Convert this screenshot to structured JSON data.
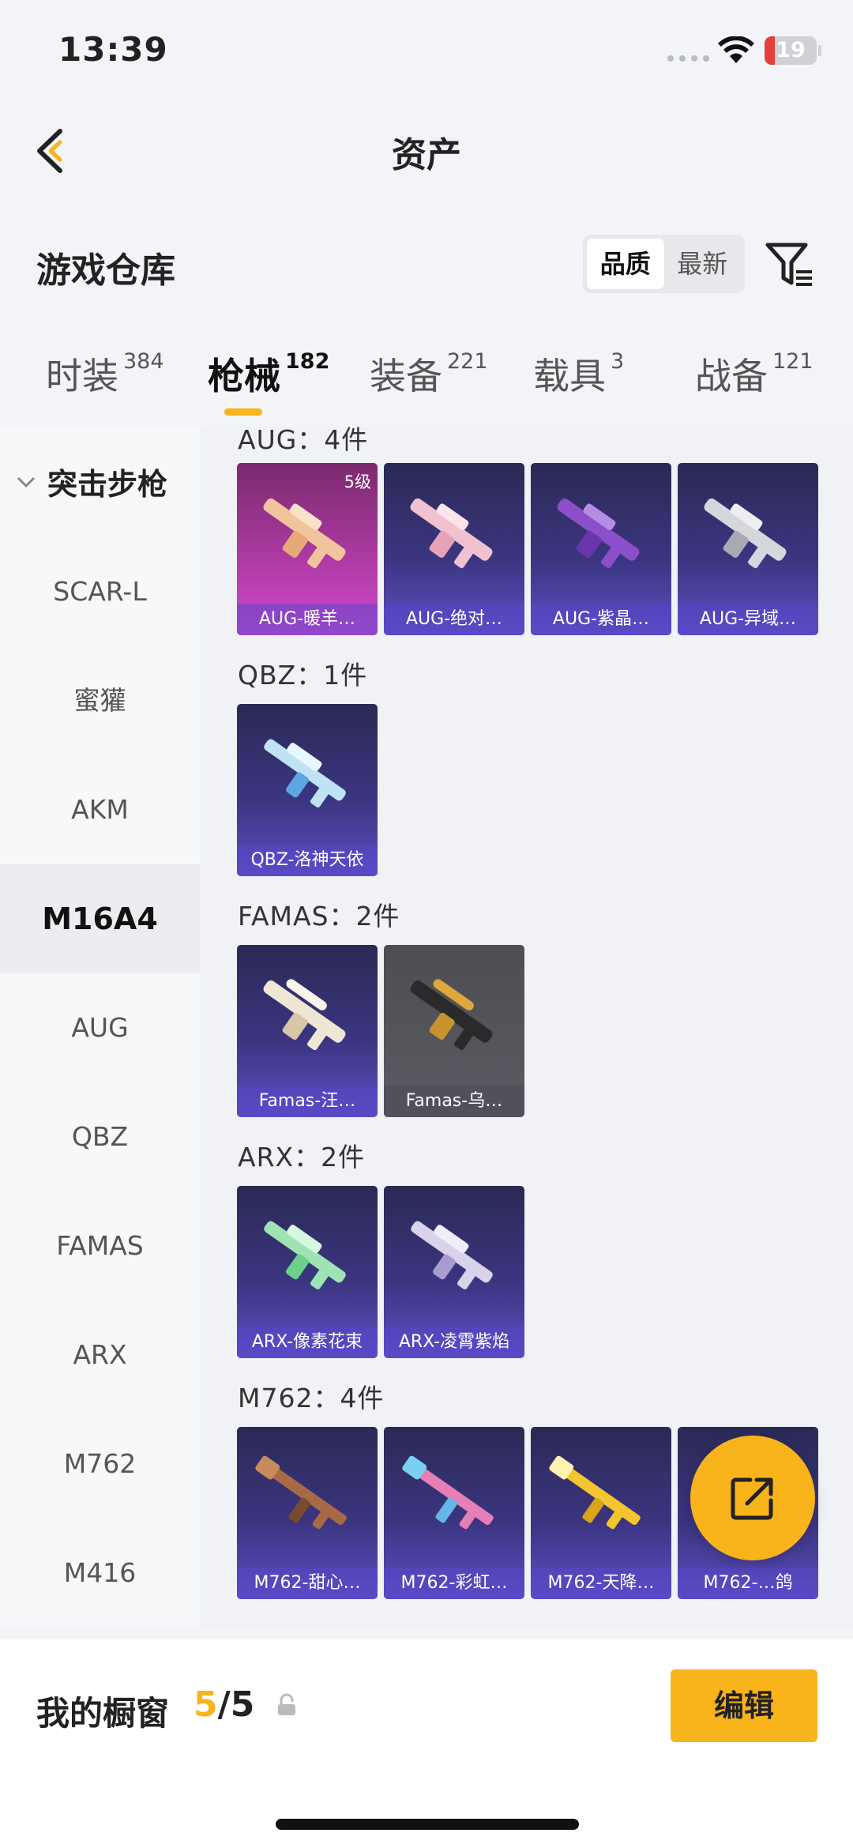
{
  "status": {
    "time": "13:39",
    "battery": "19",
    "battery_level": 0.19
  },
  "nav": {
    "title": "资产"
  },
  "header": {
    "title": "游戏仓库",
    "sort_options": [
      "品质",
      "最新"
    ],
    "sort_active": "品质"
  },
  "tabs": [
    {
      "label": "时装",
      "count": "384"
    },
    {
      "label": "枪械",
      "count": "182"
    },
    {
      "label": "装备",
      "count": "221"
    },
    {
      "label": "载具",
      "count": "3"
    },
    {
      "label": "战备",
      "count": "121"
    }
  ],
  "active_tab": "枪械",
  "sidebar": {
    "category": "突击步枪",
    "items": [
      "SCAR-L",
      "蜜獾",
      "AKM",
      "M16A4",
      "AUG",
      "QBZ",
      "FAMAS",
      "ARX",
      "M762",
      "M416"
    ],
    "active": "M16A4"
  },
  "groups": [
    {
      "title": "AUG：4件",
      "items": [
        {
          "name": "AUG-暖羊…",
          "level": "5级",
          "style": "pink"
        },
        {
          "name": "AUG-绝对…",
          "style": "purple"
        },
        {
          "name": "AUG-紫晶…",
          "style": "purple"
        },
        {
          "name": "AUG-异域…",
          "style": "purple"
        }
      ]
    },
    {
      "title": "QBZ：1件",
      "items": [
        {
          "name": "QBZ-洛神天依",
          "style": "purple"
        }
      ]
    },
    {
      "title": "FAMAS：2件",
      "items": [
        {
          "name": "Famas-汪…",
          "style": "purple"
        },
        {
          "name": "Famas-乌…",
          "style": "gray"
        }
      ]
    },
    {
      "title": "ARX：2件",
      "items": [
        {
          "name": "ARX-像素花束",
          "style": "purple"
        },
        {
          "name": "ARX-凌霄紫焰",
          "style": "purple"
        }
      ]
    },
    {
      "title": "M762：4件",
      "items": [
        {
          "name": "M762-甜心…",
          "style": "purple"
        },
        {
          "name": "M762-彩虹…",
          "style": "purple"
        },
        {
          "name": "M762-天降…",
          "style": "purple"
        },
        {
          "name": "M762-…鸽",
          "style": "purple"
        }
      ]
    }
  ],
  "bottom": {
    "showcase_label": "我的橱窗",
    "showcase_current": "5",
    "showcase_total": "/5",
    "edit_label": "编辑"
  },
  "colors": {
    "accent": "#f8b41a",
    "card_purple": "#3b3580",
    "card_pink": "#b13ba7",
    "card_gray": "#55555c"
  }
}
